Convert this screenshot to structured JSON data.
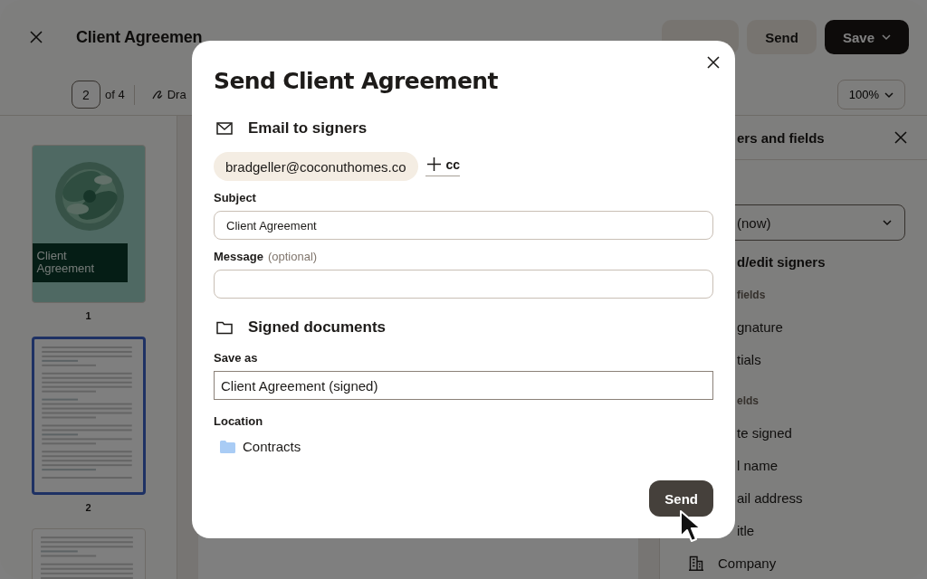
{
  "app": {
    "title": "Client Agreemen",
    "header_buttons": [
      {
        "kind": "secondary"
      },
      {
        "label": "Send",
        "kind": "secondary"
      },
      {
        "label": "Save",
        "kind": "primary"
      }
    ],
    "page_input": "2",
    "page_total": "of 4",
    "tool": "Dra",
    "zoom": "100%"
  },
  "thumbnails": [
    {
      "kind": "cover",
      "title": "Client Agreement",
      "label": "1",
      "selected": false
    },
    {
      "kind": "text",
      "label": "2",
      "selected": true
    },
    {
      "kind": "text",
      "selected": false
    }
  ],
  "side_panel": {
    "title": "ers and fields",
    "dropdown": "(now)",
    "heading": "d/edit signers",
    "groups": [
      {
        "title": "fields",
        "items": [
          {
            "label": "gnature",
            "kind": "cut"
          },
          {
            "label": "tials",
            "kind": "cut"
          }
        ]
      },
      {
        "title": "elds",
        "items": [
          {
            "label": "te signed",
            "kind": "cut"
          },
          {
            "label": "l name",
            "kind": "cut"
          },
          {
            "label": "ail address",
            "kind": "cut"
          },
          {
            "label": "itle",
            "kind": "cut"
          },
          {
            "label": "Company",
            "kind": "building"
          }
        ]
      }
    ]
  },
  "dialog": {
    "title": "Send Client Agreement",
    "email_section": {
      "title": "Email to signers",
      "recipients": [
        "bradgeller@coconuthomes.co"
      ],
      "cc_label": "cc",
      "subject": {
        "label": "Subject",
        "value": "Client Agreement"
      },
      "message": {
        "label": "Message",
        "hint": "(optional)"
      }
    },
    "documents_section": {
      "title": "Signed documents",
      "save_as": {
        "label": "Save as",
        "value": "Client Agreement (signed)"
      },
      "location": {
        "label": "Location",
        "folder": "Contracts"
      }
    },
    "send_button": "Send"
  }
}
